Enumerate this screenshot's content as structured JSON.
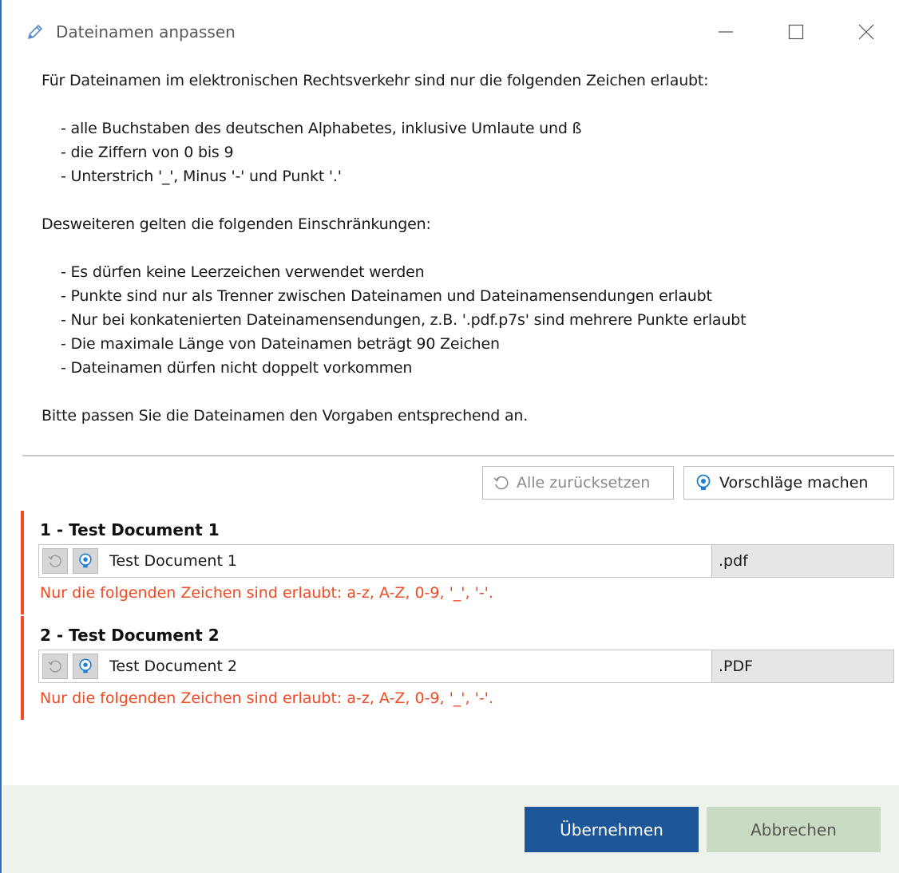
{
  "window": {
    "title": "Dateinamen anpassen",
    "icon": "pencil-icon"
  },
  "info": {
    "intro": "Für Dateinamen im elektronischen Rechtsverkehr sind nur die folgenden Zeichen erlaubt:",
    "allowed": [
      "- alle Buchstaben des deutschen Alphabetes, inklusive Umlaute und ß",
      "- die Ziffern von 0 bis 9",
      "- Unterstrich '_', Minus '-' und Punkt '.'"
    ],
    "restrictions_title": "Desweiteren gelten die folgenden Einschränkungen:",
    "restrictions": [
      "- Es dürfen keine Leerzeichen verwendet werden",
      "- Punkte sind nur als Trenner zwischen Dateinamen und Dateinamensendungen erlaubt",
      "- Nur bei konkatenierten Dateinamensendungen, z.B. '.pdf.p7s' sind mehrere Punkte erlaubt",
      "- Die maximale Länge von Dateinamen beträgt 90 Zeichen",
      "- Dateinamen dürfen nicht doppelt vorkommen"
    ],
    "closing": "Bitte passen Sie die Dateinamen den Vorgaben entsprechend an."
  },
  "toolbar": {
    "reset_all_label": "Alle zurücksetzen",
    "suggest_label": "Vorschläge machen"
  },
  "documents": [
    {
      "title": "1  - Test Document 1",
      "name": "Test Document 1",
      "extension": ".pdf",
      "error": "Nur die folgenden Zeichen sind erlaubt: a-z, A-Z, 0-9, '_', '-'."
    },
    {
      "title": "2  - Test Document 2",
      "name": "Test Document 2",
      "extension": ".PDF",
      "error": "Nur die folgenden Zeichen sind erlaubt: a-z, A-Z, 0-9, '_', '-'."
    }
  ],
  "footer": {
    "ok_label": "Übernehmen",
    "cancel_label": "Abbrechen"
  },
  "colors": {
    "accent": "#1e5799",
    "error": "#f04a23",
    "footer_bg": "#eef2ec"
  }
}
